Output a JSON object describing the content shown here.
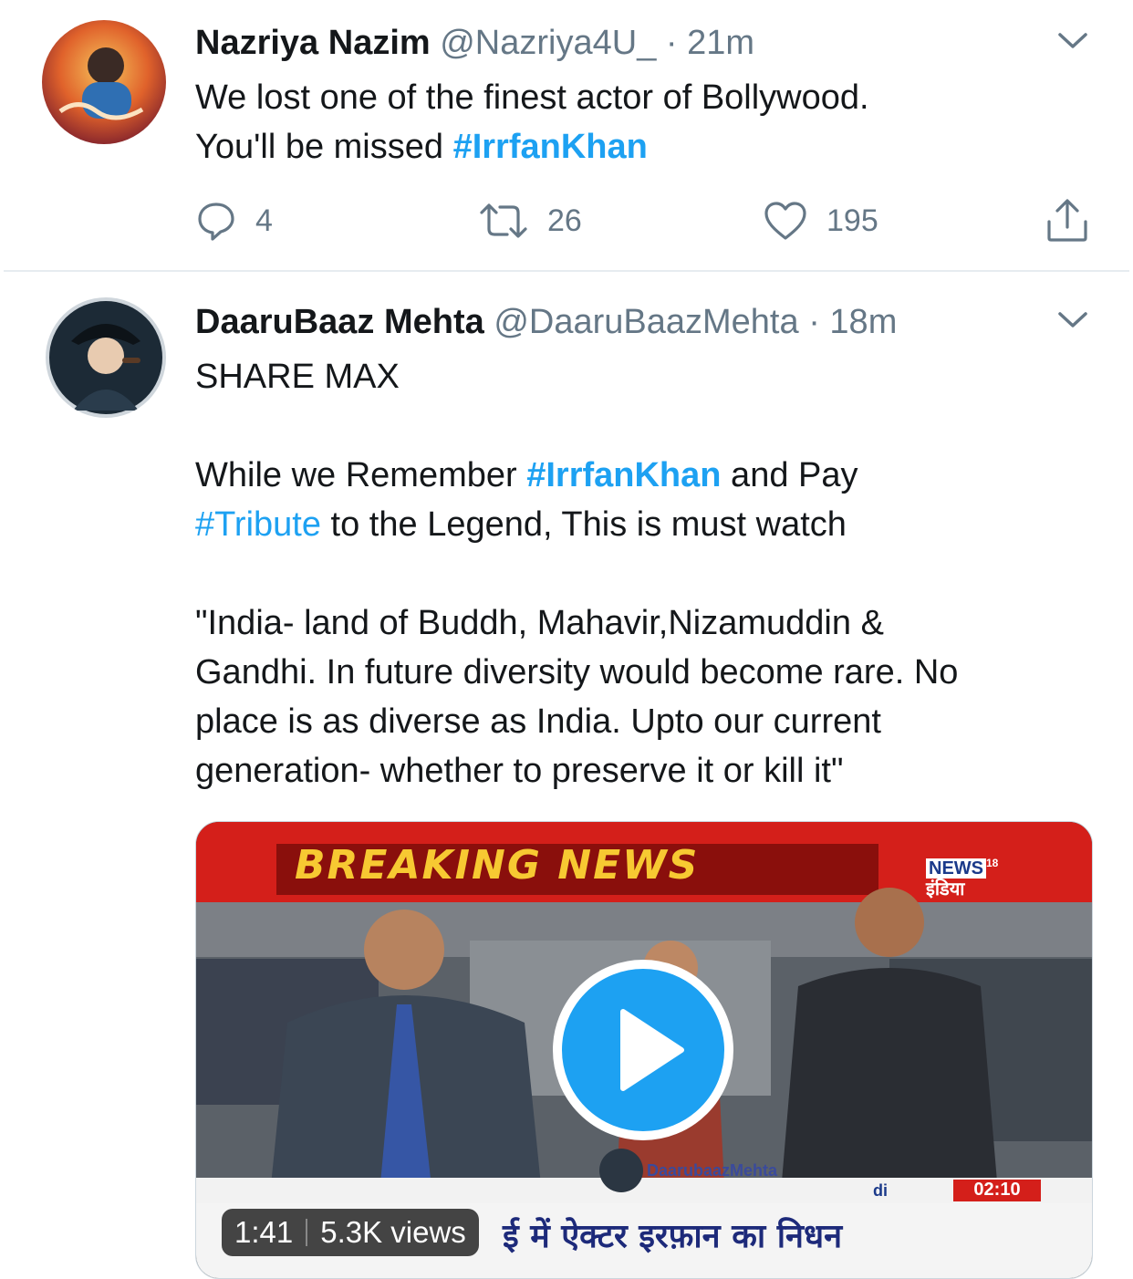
{
  "tweets": [
    {
      "name": "Nazriya Nazim",
      "handle": "@Nazriya4U_",
      "separator": "·",
      "time": "21m",
      "text_lines": [
        {
          "plain": "We lost one of the finest actor of Bollywood."
        },
        {
          "plain": "You'll be missed ",
          "hashtag": "#IrrfanKhan"
        }
      ],
      "replies": "4",
      "retweets": "26",
      "likes": "195"
    },
    {
      "name": "DaaruBaaz Mehta",
      "handle": "@DaaruBaazMehta",
      "separator": "·",
      "time": "18m",
      "para1": "SHARE MAX",
      "para2": {
        "line1_a": "While we Remember ",
        "line1_tag": "#IrrfanKhan",
        "line1_b": " and Pay",
        "line2_tag": "#Tribute",
        "line2_b": " to the Legend, This is must watch"
      },
      "para3_lines": [
        "\"India- land of Buddh, Mahavir,Nizamuddin &",
        "Gandhi. In future diversity would become rare. No",
        "place is as diverse as India. Upto our current",
        "generation- whether to preserve it or kill it\""
      ],
      "video": {
        "banner": "BREAKING NEWS",
        "channel_line1": "NEWS",
        "channel_sup": "18",
        "channel_line2": "इंडिया",
        "watermark": "DaarubaazMehta",
        "clock": "02:10",
        "ticker_label": "di",
        "ticker_text": "ई में ऐक्टर इरफ़ान का निधन",
        "duration": "1:41",
        "views": "5.3K views"
      }
    }
  ],
  "colors": {
    "link": "#1da1f2",
    "secondary": "#657786",
    "divider": "#e6ecf0"
  },
  "icons": [
    "chevron-down-icon",
    "reply-icon",
    "retweet-icon",
    "like-icon",
    "share-icon",
    "play-icon"
  ]
}
